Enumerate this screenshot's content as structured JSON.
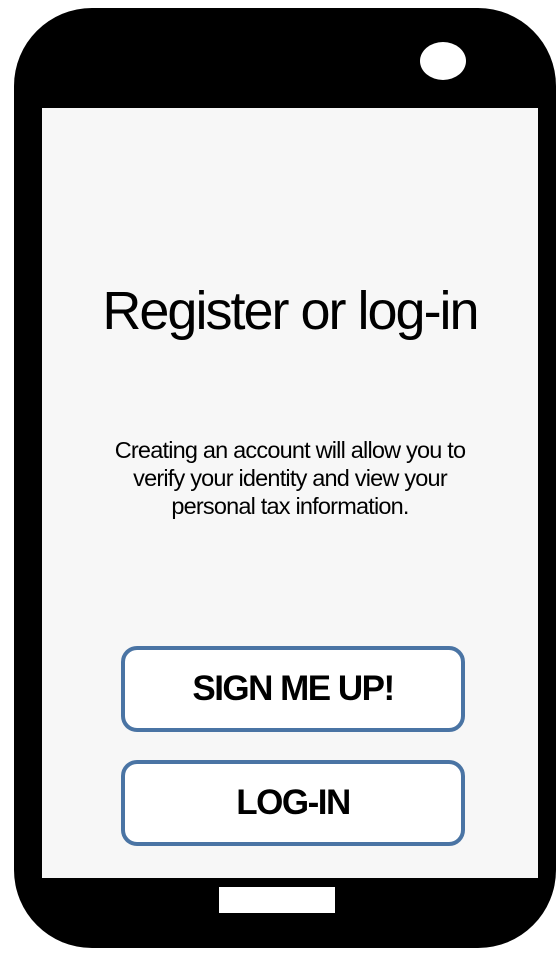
{
  "screen": {
    "title": "Register or log-in",
    "description_lines": [
      "Creating an account will allow you to",
      "verify your identity and view your",
      "personal tax information."
    ],
    "signup_label": "SIGN ME UP!",
    "login_label": "LOG-IN"
  },
  "colors": {
    "phone_body": "#000000",
    "screen_background": "#f7f7f7",
    "button_border": "#4a74a4",
    "button_background": "#ffffff"
  }
}
